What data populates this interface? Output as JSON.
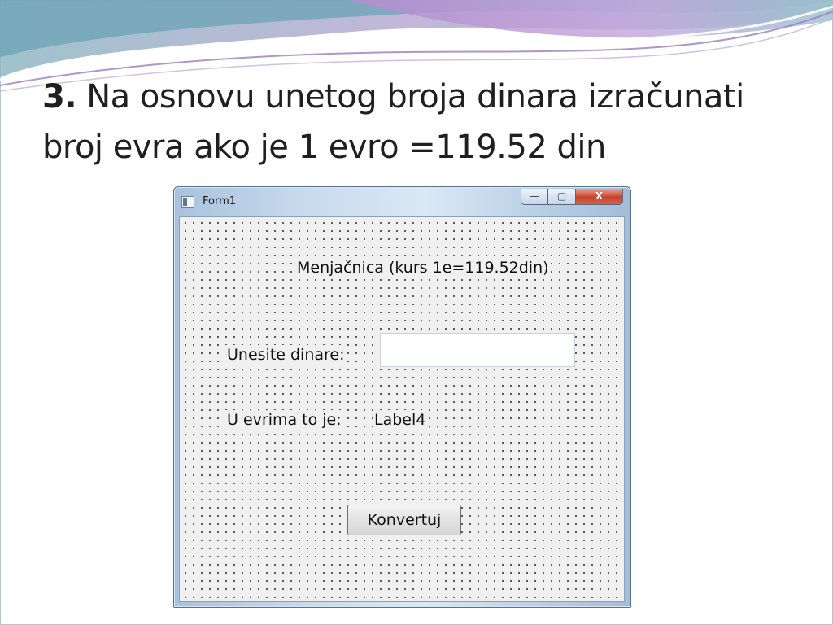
{
  "slide": {
    "title_number": "3.",
    "title_line1": "Na osnovu unetog broja dinara izračunati",
    "title_line2": "broj evra ako je 1 evro =119.52 din"
  },
  "window": {
    "title": "Form1",
    "icon": "form-window-icon",
    "controls": {
      "minimize": "—",
      "maximize": "▢",
      "close": "X"
    }
  },
  "form": {
    "heading": "Menjačnica (kurs  1e=119.52din)",
    "dinars_label": "Unesite dinare:",
    "dinars_value": "",
    "result_label": "U evrima to je:",
    "result_value": "Label4",
    "convert_button": "Konvertuj"
  },
  "colors": {
    "wave_purple": "#a78fc2",
    "wave_teal": "#7fb0bf",
    "close_red": "#c7432b"
  }
}
